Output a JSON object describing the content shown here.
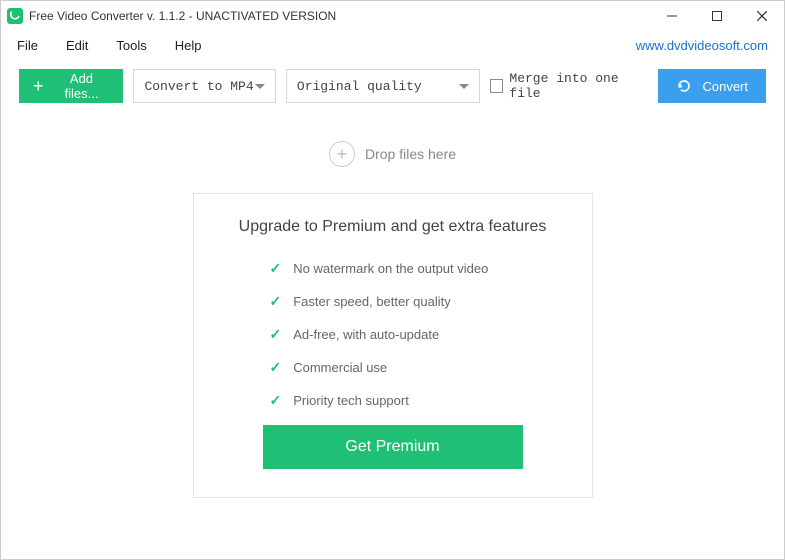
{
  "titlebar": {
    "title": "Free Video Converter v. 1.1.2 - UNACTIVATED VERSION"
  },
  "menubar": {
    "items": [
      "File",
      "Edit",
      "Tools",
      "Help"
    ],
    "website": "www.dvdvideosoft.com"
  },
  "toolbar": {
    "add_files_label": "Add files...",
    "format_selected": "Convert to MP4",
    "quality_selected": "Original quality",
    "merge_label": "Merge into one file",
    "convert_label": "Convert"
  },
  "drop_hint": "Drop files here",
  "premium": {
    "title": "Upgrade to Premium and get extra features",
    "features": [
      "No watermark on the output video",
      "Faster speed, better quality",
      "Ad-free, with auto-update",
      "Commercial use",
      "Priority tech support"
    ],
    "cta_label": "Get Premium"
  },
  "colors": {
    "green": "#1fbf75",
    "blue_button": "#3b9ff0",
    "link_blue": "#1a6fd8"
  }
}
